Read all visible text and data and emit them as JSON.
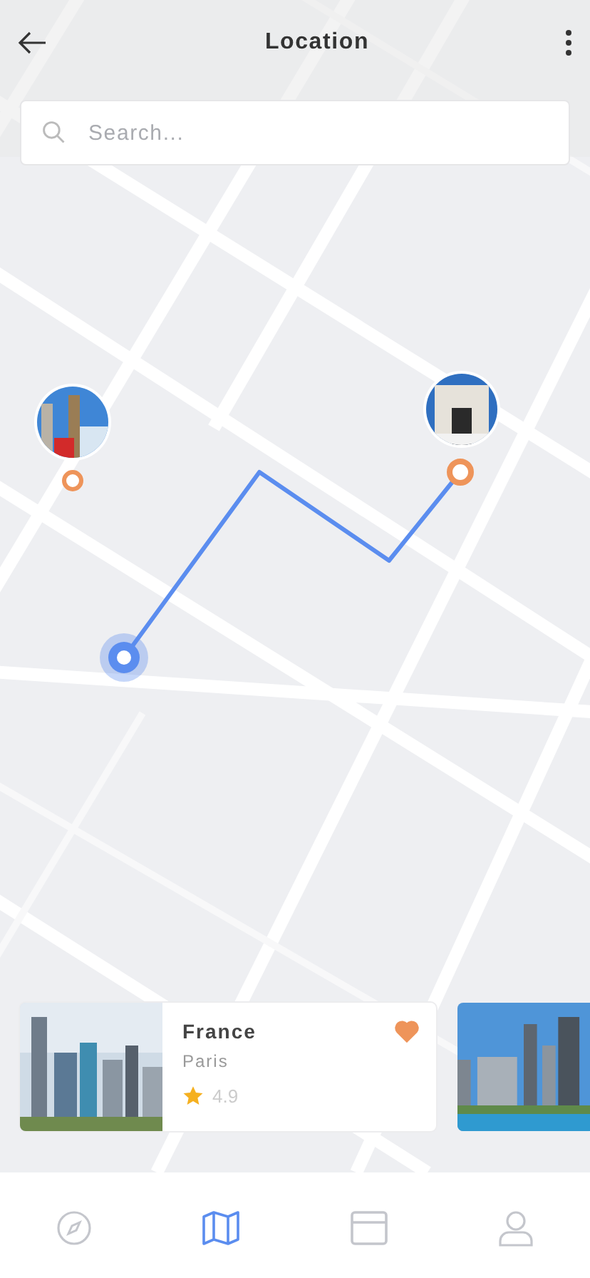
{
  "header": {
    "title": "Location"
  },
  "search": {
    "placeholder": "Search..."
  },
  "cards": [
    {
      "kind": "place",
      "title": "France",
      "subtitle": "Paris",
      "rating": "4.9",
      "favorite": true
    },
    {
      "kind": "picture"
    }
  ],
  "nav": [
    {
      "kind": "compass",
      "selected": false
    },
    {
      "kind": "map",
      "selected": true
    },
    {
      "kind": "window",
      "selected": false
    },
    {
      "kind": "user",
      "selected": false
    }
  ]
}
